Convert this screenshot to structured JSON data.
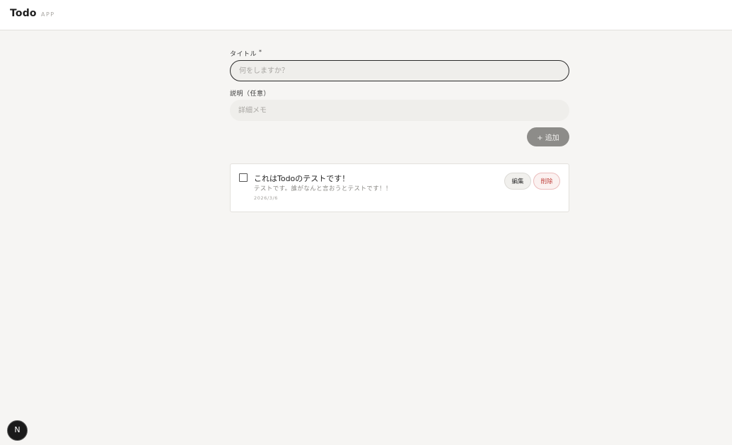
{
  "header": {
    "brand": "Todo",
    "brand_sub": "APP"
  },
  "form": {
    "title_label": "タイトル",
    "required_mark": "*",
    "title_placeholder": "何をしますか？",
    "title_value": "",
    "desc_label": "説明（任意）",
    "desc_placeholder": "詳細メモ",
    "desc_value": "",
    "add_label": "+ 追加"
  },
  "todos": [
    {
      "title": "これはTodoのテストです！",
      "description": "テストです。誰がなんと言おうとテストです！！",
      "date": "2026/3/6",
      "done": false,
      "edit_label": "編集",
      "delete_label": "削除"
    }
  ],
  "dev_badge": {
    "label": "N",
    "icon": "nextjs-icon"
  },
  "colors": {
    "background": "#f6f5f3",
    "accent_dark": "#2a2a2a",
    "add_button": "#8d8c89",
    "delete_text": "#c0443f"
  }
}
